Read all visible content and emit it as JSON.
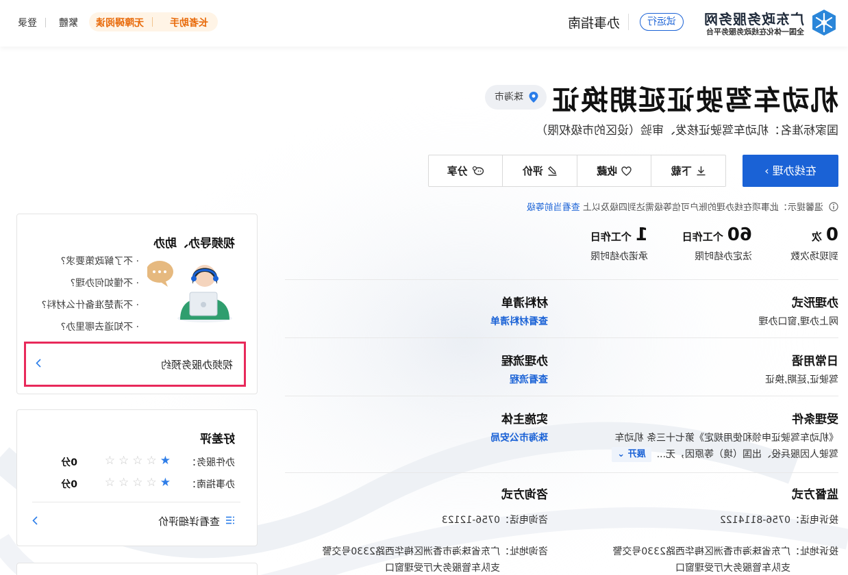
{
  "header": {
    "logo_title": "广东政务服务网",
    "logo_subtitle": "全国一体化在线政务服务平台",
    "trial_badge": "试运行",
    "nav_guide": "办事指南",
    "elder_assist": "长者助手",
    "barrier_free": "无障碍阅读",
    "traditional": "繁體",
    "login": "登录",
    "accent_color": "#1a62d6"
  },
  "title": {
    "name": "机动车驾驶证延期换证",
    "location": "珠海市",
    "standard_name": "国家标准名：机动车驾驶证核发、审验（设区的市级权限）"
  },
  "actions": {
    "online": "在线办理 ›",
    "download": "下载",
    "favorite": "收藏",
    "evaluate": "评价",
    "share": "分享"
  },
  "tip": {
    "text": "温馨提示：此事项在线办理的账户可信等级需达到四级及以上",
    "link": "查看当前等级"
  },
  "stats": [
    {
      "num": "0",
      "unit": "次",
      "label": "到现场次数"
    },
    {
      "num": "60",
      "unit": "个工作日",
      "label": "法定办结时限"
    },
    {
      "num": "1",
      "unit": "个工作日",
      "label": "承诺办结时限"
    }
  ],
  "info": {
    "form_key": "办理形式",
    "form_val": "网上办理,窗口办理",
    "materials_key": "材料清单",
    "materials_link": "查看材料清单",
    "common_key": "日常用语",
    "common_val": "驾驶证,延期,换证",
    "process_key": "办理流程",
    "process_link": "查看流程",
    "condition_key": "受理条件",
    "condition_val1": "《机动车驾驶证申领和使用规定》第七十三条 机动车",
    "condition_val2": "驾驶人因服兵役、出国（境）等原因，无...",
    "expand": "展开",
    "subject_key": "实施主体",
    "subject_link": "珠海市公安局",
    "supervise_key": "监督方式",
    "supervise_phone": "投诉电话：0756-8114122",
    "supervise_addr1": "投诉地址：广东省珠海市香洲区梅华西路2330号交警",
    "supervise_addr2": "支队车管服务大厅受理窗口",
    "consult_key": "咨询方式",
    "consult_phone": "咨询电话：0756-12123",
    "consult_addr1": "咨询地址：广东省珠海市香洲区梅华西路2330号交警",
    "consult_addr2": "支队车管服务大厅受理窗口"
  },
  "video_help": {
    "title": "视频导办、助办",
    "items": [
      "· 不了解政策要求?",
      "· 不懂如何办理?",
      "· 不清楚准备什么材料?",
      "· 不知道去哪里办?"
    ],
    "link": "视频办服务预约"
  },
  "rating": {
    "title": "好差评",
    "rows": [
      {
        "label": "办件服务：",
        "score": "0分",
        "stars_on": 1
      },
      {
        "label": "办事指南：",
        "score": "0分",
        "stars_on": 1
      }
    ],
    "detail_link": "查看详细评价"
  }
}
